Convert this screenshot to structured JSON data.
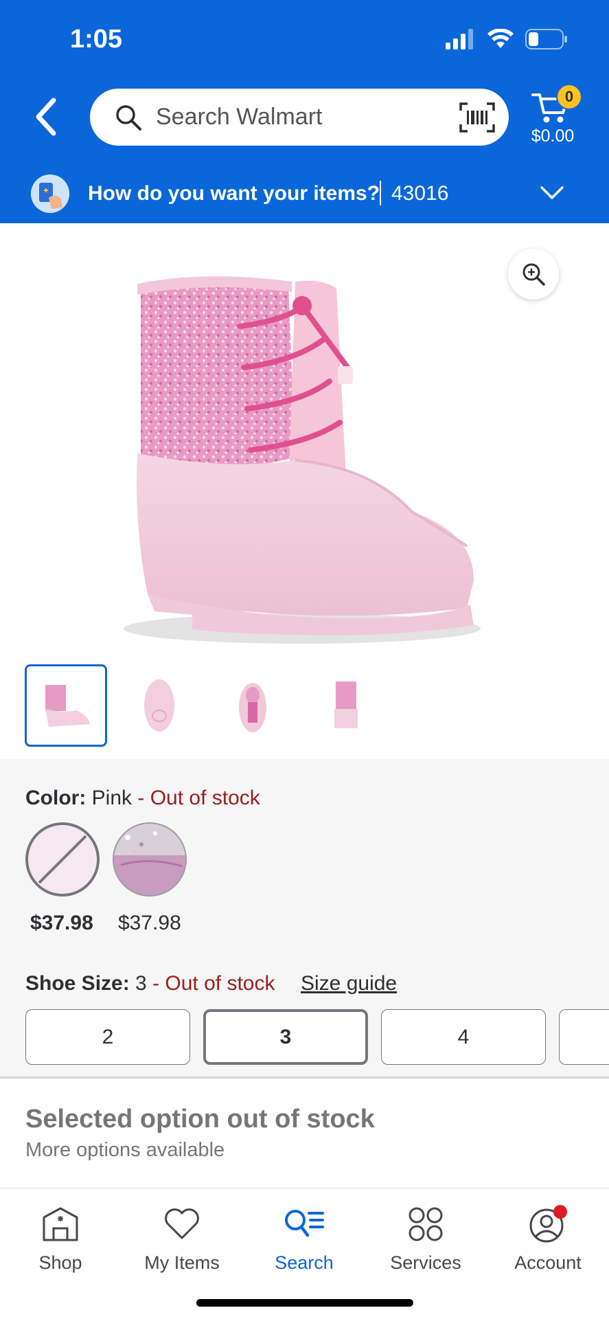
{
  "status_bar": {
    "time": "1:05"
  },
  "header": {
    "search_placeholder": "Search Walmart",
    "cart_count": "0",
    "cart_total": "$0.00",
    "delivery_question": "How do you want your items?",
    "zip_code": "43016"
  },
  "product": {
    "image_count": 4,
    "active_image_index": 0
  },
  "color": {
    "label": "Color:",
    "value": "Pink",
    "status": "- Out of stock",
    "swatches": [
      {
        "name": "Pink",
        "price": "$37.98",
        "selected": true,
        "out_of_stock": true
      },
      {
        "name": "Glitter Lilac",
        "price": "$37.98",
        "selected": false,
        "out_of_stock": false
      }
    ]
  },
  "size": {
    "label": "Shoe Size:",
    "value": "3",
    "status": "- Out of stock",
    "guide_link": "Size guide",
    "options": [
      "2",
      "3",
      "4"
    ],
    "selected": "3"
  },
  "stock_notice": {
    "title": "Selected option out of stock",
    "subtitle": "More options available"
  },
  "tabs": [
    {
      "label": "Shop",
      "icon": "store-icon"
    },
    {
      "label": "My Items",
      "icon": "heart-icon"
    },
    {
      "label": "Search",
      "icon": "search-list-icon",
      "active": true
    },
    {
      "label": "Services",
      "icon": "services-grid-icon"
    },
    {
      "label": "Account",
      "icon": "account-icon"
    }
  ],
  "colors": {
    "brand_blue": "#0a66d9",
    "badge_yellow": "#ffc220",
    "out_of_stock_red": "#9b1c1c"
  }
}
